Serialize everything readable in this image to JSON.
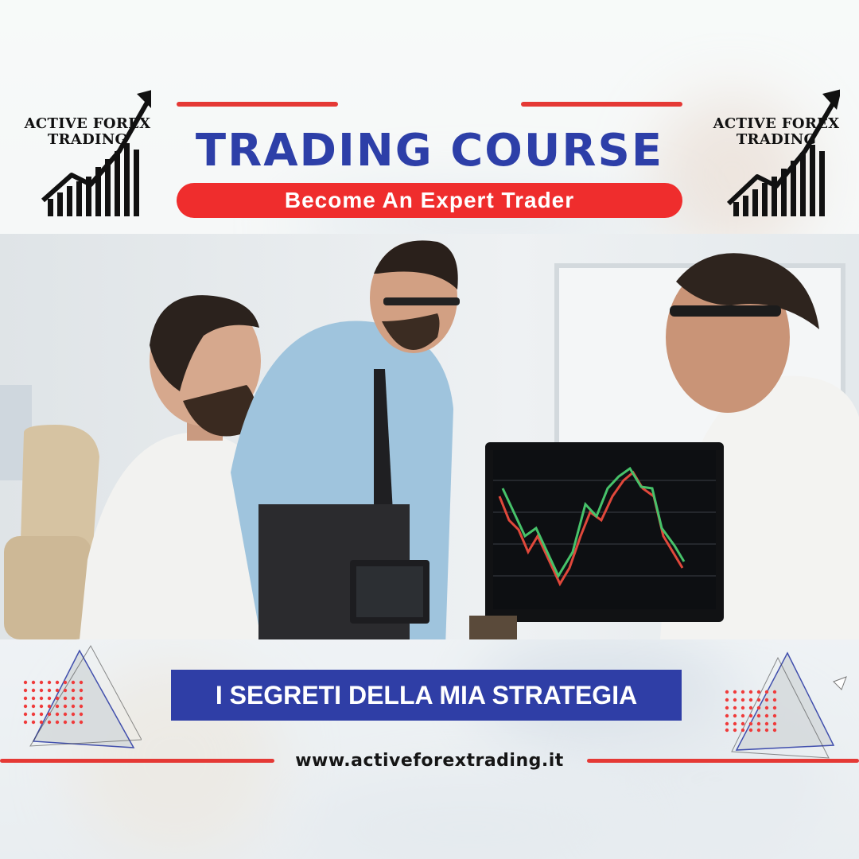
{
  "brand": {
    "logo_text": "ACTIVE FOREX\nTRADING"
  },
  "header": {
    "title": "TRADING COURSE",
    "subtitle": "Become An Expert Trader"
  },
  "footer": {
    "banner": "I SEGRETI DELLA MIA STRATEGIA",
    "url": "www.activeforextrading.it"
  },
  "colors": {
    "accent_red": "#e53935",
    "title_blue": "#2d3fa8",
    "banner_blue": "#2f3ea6"
  },
  "icons": [
    "trending-up-arrow-icon",
    "bar-growth-icon",
    "triangle-decor-icon",
    "dot-grid-decor-icon"
  ]
}
